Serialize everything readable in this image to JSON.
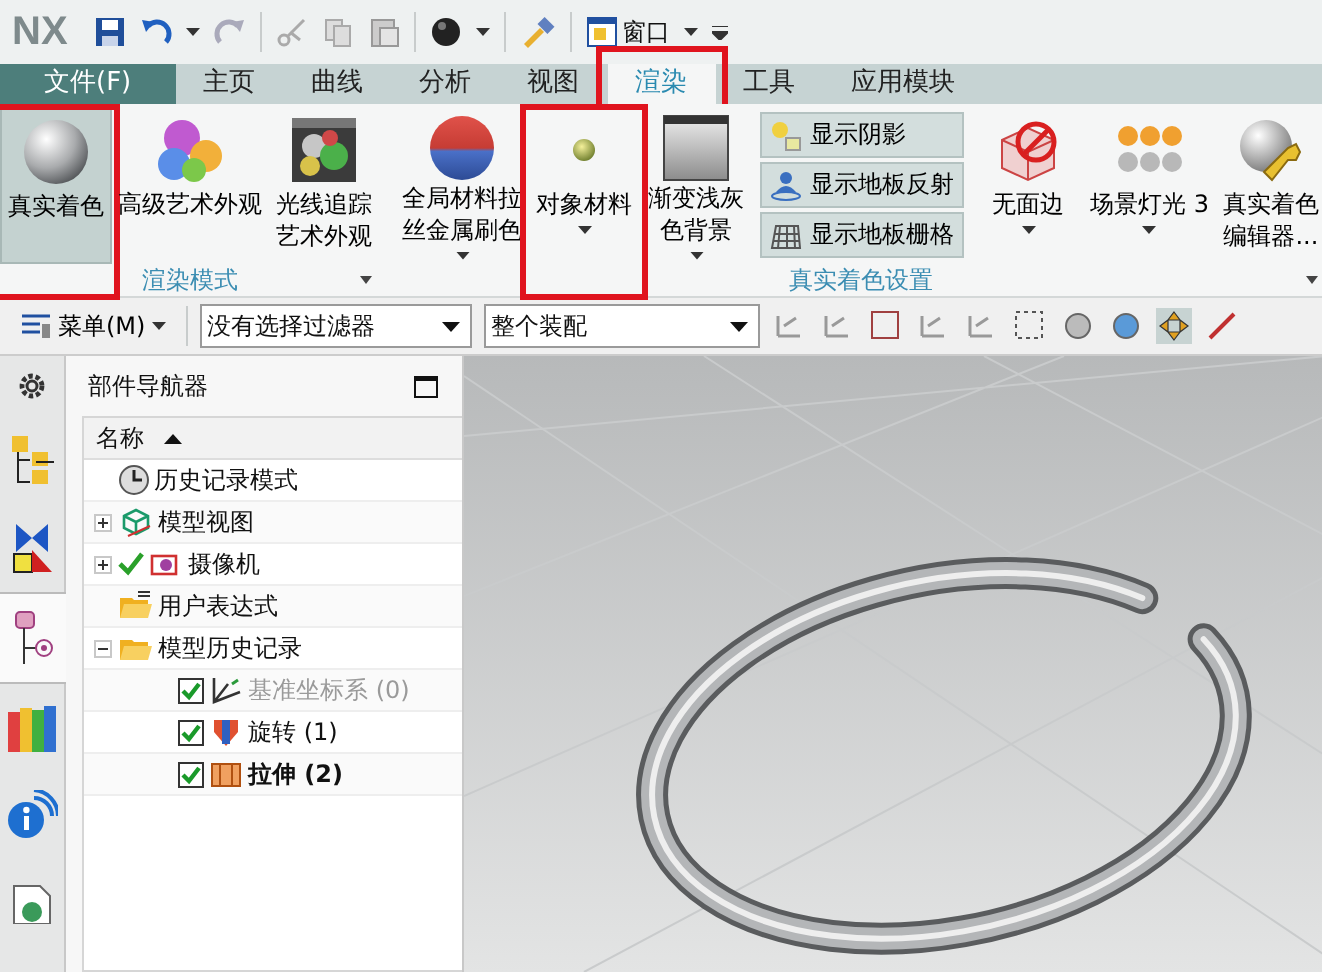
{
  "quick_access": {
    "logo": "NX",
    "window_label": "窗口"
  },
  "tabs": [
    {
      "label": "文件(F)",
      "kind": "file",
      "selected": false,
      "highlighted": false
    },
    {
      "label": "主页",
      "kind": "tab",
      "selected": false,
      "highlighted": false
    },
    {
      "label": "曲线",
      "kind": "tab",
      "selected": false,
      "highlighted": false
    },
    {
      "label": "分析",
      "kind": "tab",
      "selected": false,
      "highlighted": false
    },
    {
      "label": "视图",
      "kind": "tab",
      "selected": false,
      "highlighted": false
    },
    {
      "label": "渲染",
      "kind": "tab",
      "selected": true,
      "highlighted": true
    },
    {
      "label": "工具",
      "kind": "tab",
      "selected": false,
      "highlighted": false
    },
    {
      "label": "应用模块",
      "kind": "tab",
      "selected": false,
      "highlighted": false
    }
  ],
  "ribbon": {
    "groups": [
      {
        "label": "渲染模式",
        "items": [
          {
            "kind": "large",
            "lines": [
              "真实着色"
            ],
            "selected": true,
            "highlighted": true,
            "has_menu": false
          },
          {
            "kind": "large",
            "lines": [
              "高级艺术外观"
            ],
            "selected": false,
            "highlighted": false,
            "has_menu": false
          },
          {
            "kind": "large",
            "lines": [
              "光线追踪",
              "艺术外观"
            ],
            "selected": false,
            "highlighted": false,
            "has_menu": false
          }
        ]
      },
      {
        "label": "真实着色设置",
        "items": [
          {
            "kind": "large",
            "lines": [
              "全局材料拉",
              "丝金属刷色"
            ],
            "selected": false,
            "highlighted": false,
            "has_menu": true
          },
          {
            "kind": "large",
            "lines": [
              "对象材料"
            ],
            "selected": false,
            "highlighted": true,
            "has_menu": true
          },
          {
            "kind": "large",
            "lines": [
              "渐变浅灰",
              "色背景"
            ],
            "selected": false,
            "highlighted": false,
            "has_menu": true
          },
          {
            "kind": "stack",
            "buttons": [
              {
                "label": "显示阴影",
                "on": true
              },
              {
                "label": "显示地板反射",
                "on": true
              },
              {
                "label": "显示地板栅格",
                "on": true
              }
            ]
          },
          {
            "kind": "large",
            "lines": [
              "无面边"
            ],
            "selected": false,
            "highlighted": false,
            "has_menu": true
          },
          {
            "kind": "large",
            "lines": [
              "场景灯光 3"
            ],
            "selected": false,
            "highlighted": false,
            "has_menu": true
          },
          {
            "kind": "large",
            "lines": [
              "真实着色",
              "编辑器..."
            ],
            "selected": false,
            "highlighted": false,
            "has_menu": false
          }
        ]
      }
    ]
  },
  "toolbar": {
    "menu_label": "菜单(M)",
    "filter": "没有选择过滤器",
    "scope": "整个装配"
  },
  "side_tabs": [
    {
      "selected": false
    },
    {
      "selected": false
    },
    {
      "selected": false
    },
    {
      "selected": true
    },
    {
      "selected": false
    },
    {
      "selected": false
    },
    {
      "selected": false
    }
  ],
  "navigator": {
    "title": "部件导航器",
    "column": "名称",
    "tree": [
      {
        "label": "历史记录模式"
      },
      {
        "label": "模型视图",
        "expanded": false
      },
      {
        "label": "摄像机",
        "expanded": false,
        "shown": true
      },
      {
        "label": "用户表达式"
      },
      {
        "label": "模型历史记录",
        "expanded": true,
        "children": [
          {
            "label": "基准坐标系 (0)",
            "checked": true,
            "disabled": true,
            "current": false
          },
          {
            "label": "旋转 (1)",
            "checked": true,
            "disabled": false,
            "current": false
          },
          {
            "label": "拉伸 (2)",
            "checked": true,
            "disabled": false,
            "current": true
          }
        ]
      }
    ]
  }
}
